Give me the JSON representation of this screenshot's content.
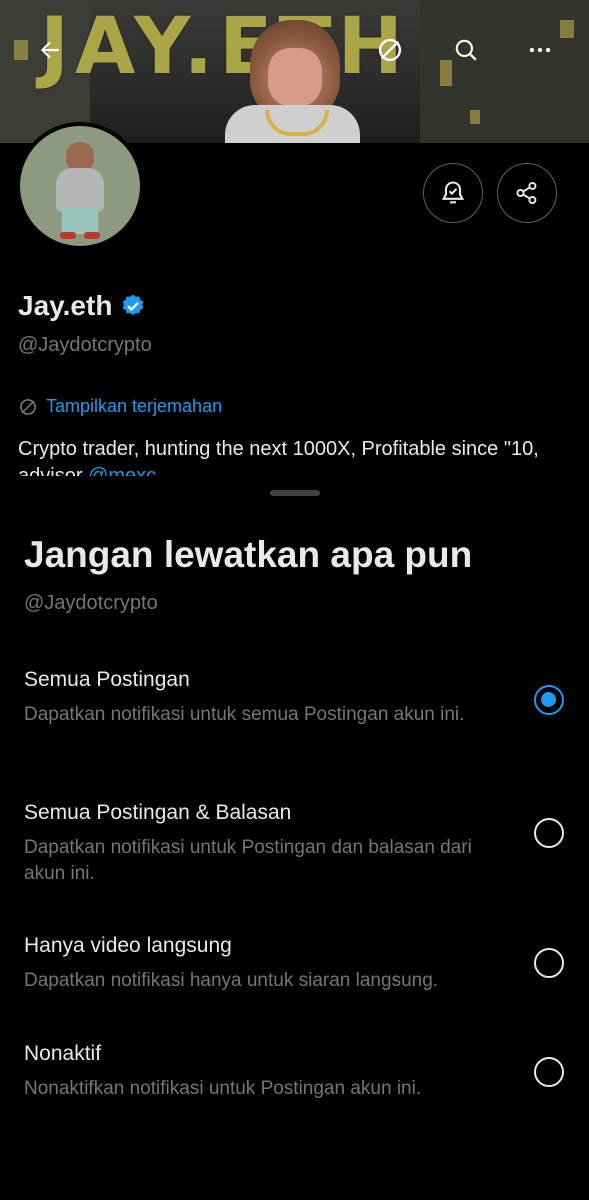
{
  "banner": {
    "text": "JAY.ETH"
  },
  "profile": {
    "name": "Jay.eth",
    "handle": "@Jaydotcrypto",
    "translate_label": "Tampilkan terjemahan",
    "bio_text": "Crypto trader, hunting the next 1000X, Profitable since \"10, advisor ",
    "bio_link": "@mexc"
  },
  "sheet": {
    "title": "Jangan lewatkan apa pun",
    "handle": "@Jaydotcrypto",
    "options": [
      {
        "title": "Semua Postingan",
        "desc": "Dapatkan notifikasi untuk semua Postingan akun ini.",
        "selected": true
      },
      {
        "title": "Semua Postingan & Balasan",
        "desc": "Dapatkan notifikasi untuk Postingan dan balasan dari akun ini.",
        "selected": false
      },
      {
        "title": "Hanya video langsung",
        "desc": "Dapatkan notifikasi hanya untuk siaran langsung.",
        "selected": false
      },
      {
        "title": "Nonaktif",
        "desc": "Nonaktifkan notifikasi untuk Postingan akun ini.",
        "selected": false
      }
    ]
  },
  "icons": {
    "back": "arrow-left-icon",
    "translate": "translate-icon",
    "search": "search-icon",
    "more": "more-icon",
    "notify": "bell-check-icon",
    "share": "share-icon",
    "verified": "verified-badge-icon"
  },
  "colors": {
    "accent": "#1d9bf0",
    "background": "#000000",
    "muted": "#71767b",
    "text": "#e7e9ea"
  }
}
